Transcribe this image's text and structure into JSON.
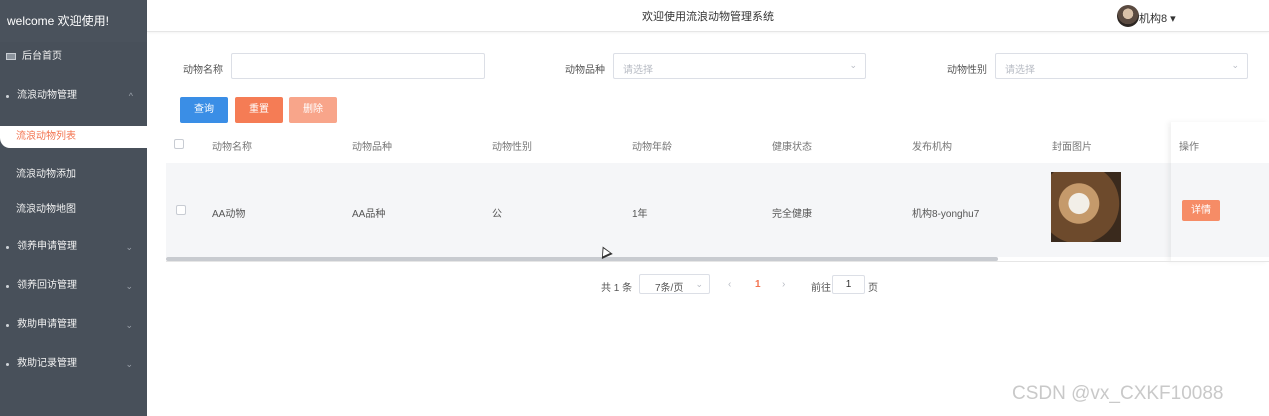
{
  "sidebar": {
    "brand": "welcome 欢迎使用!",
    "home": "后台首页",
    "groups": [
      {
        "label": "流浪动物管理",
        "chevron": "^"
      },
      {
        "label": "领养申请管理",
        "chevron": "⌄"
      },
      {
        "label": "领养回访管理",
        "chevron": "⌄"
      },
      {
        "label": "救助申请管理",
        "chevron": "⌄"
      },
      {
        "label": "救助记录管理",
        "chevron": "⌄"
      }
    ],
    "sub_items": [
      "流浪动物列表",
      "流浪动物添加",
      "流浪动物地图"
    ],
    "active_item": "流浪动物列表"
  },
  "header": {
    "title": "欢迎使用流浪动物管理系统",
    "user_name": "机构8 ▾"
  },
  "search": {
    "name_label": "动物名称",
    "name_value": "",
    "breed_label": "动物品种",
    "breed_placeholder": "请选择",
    "gender_label": "动物性别",
    "gender_placeholder": "请选择",
    "query_button": "查询",
    "reset_button": "重置",
    "delete_button": "删除"
  },
  "table": {
    "columns": [
      "动物名称",
      "动物品种",
      "动物性别",
      "动物年龄",
      "健康状态",
      "发布机构",
      "封面图片",
      "操作"
    ],
    "rows": [
      {
        "name": "AA动物",
        "breed": "AA品种",
        "gender": "公",
        "age": "1年",
        "health": "完全健康",
        "org": "机构8-yonghu7",
        "action": "详情"
      }
    ]
  },
  "pagination": {
    "total": "共 1 条",
    "page_size": "7条/页",
    "prev": "‹",
    "current": "1",
    "next": "›",
    "goto_prefix": "前往",
    "goto_value": "1",
    "goto_suffix": "页"
  },
  "watermark": "CSDN @vx_CXKF10088",
  "colors": {
    "sidebar_bg": "#48505a",
    "accent": "#f3734f",
    "query_blue": "#3a8ee6",
    "reset_orange": "#f57c55",
    "delete_orange": "#f8a58a"
  }
}
